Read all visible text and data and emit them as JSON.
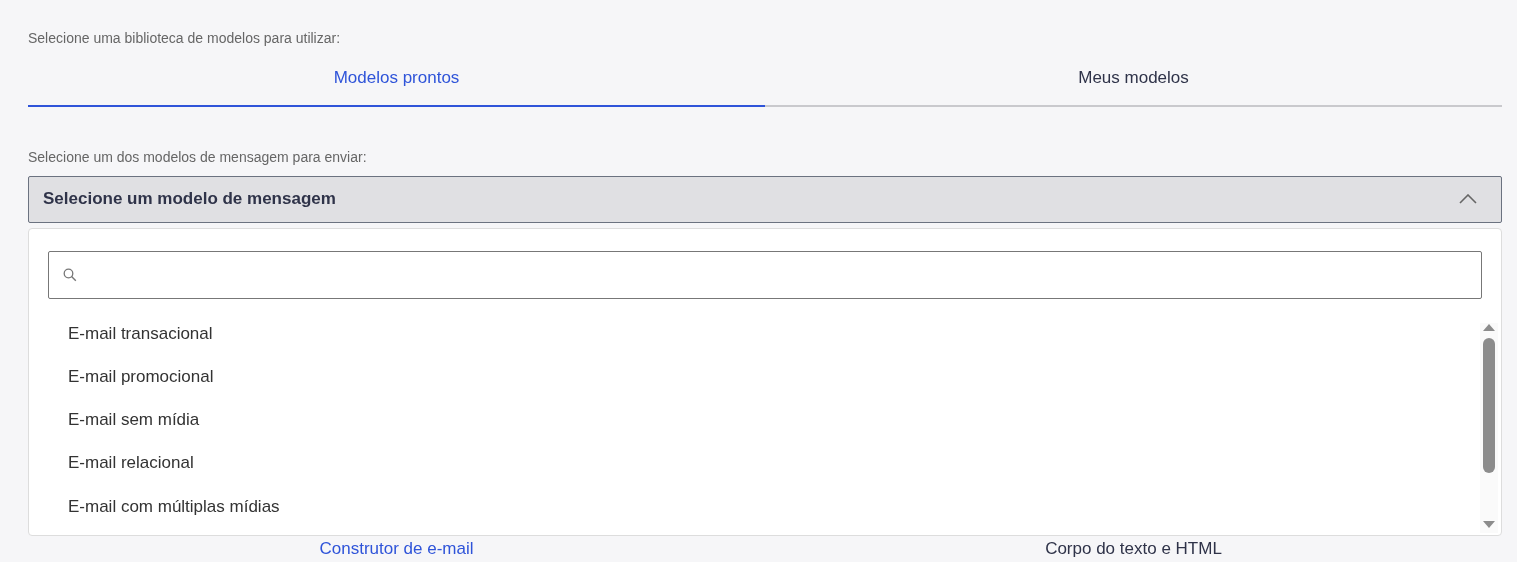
{
  "library_prompt": "Selecione uma biblioteca de modelos para utilizar:",
  "library_tabs": [
    {
      "label": "Modelos prontos",
      "selected": true
    },
    {
      "label": "Meus modelos",
      "selected": false
    }
  ],
  "template_prompt": "Selecione um dos modelos de mensagem para enviar:",
  "template_select": {
    "value": "Selecione um modelo de mensagem",
    "expanded": true,
    "options": [
      "E-mail transacional",
      "E-mail promocional",
      "E-mail sem mídia",
      "E-mail relacional",
      "E-mail com múltiplas mídias"
    ]
  },
  "editor_tabs": [
    {
      "label": "Construtor de e-mail",
      "selected": true
    },
    {
      "label": "Corpo do texto e HTML",
      "selected": false
    }
  ]
}
